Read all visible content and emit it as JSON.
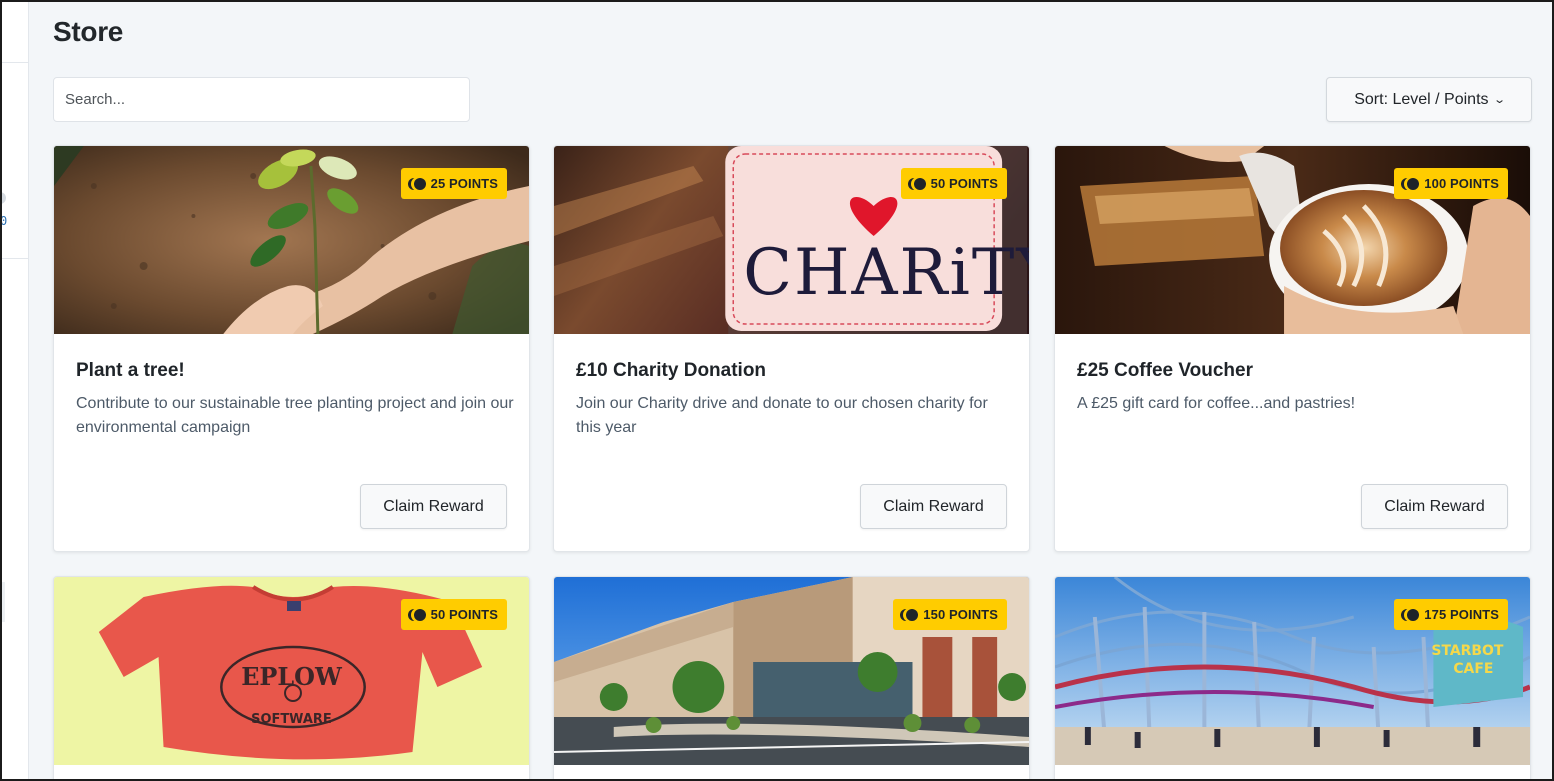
{
  "page": {
    "title": "Store"
  },
  "search": {
    "placeholder": "Search..."
  },
  "sort": {
    "label": "Sort: Level / Points",
    "icon": "chevron-down-icon"
  },
  "theme": {
    "badge_color": "#ffcc00",
    "background": "#f3f6f9"
  },
  "rewards": [
    {
      "points_label": "25 POINTS",
      "title": "Plant a tree!",
      "description": "Contribute to our sustainable tree planting project and join our environmental campaign",
      "button": "Claim Reward",
      "image": "seedling-planting-photo"
    },
    {
      "points_label": "50 POINTS",
      "title": "£10 Charity Donation",
      "description": "Join our Charity drive and donate to our chosen charity for this year",
      "button": "Claim Reward",
      "image": "charity-jar-photo"
    },
    {
      "points_label": "100 POINTS",
      "title": "£25 Coffee Voucher",
      "description": "A £25 gift card for coffee...and pastries!",
      "button": "Claim Reward",
      "image": "latte-art-photo"
    },
    {
      "points_label": "50 POINTS",
      "image": "eplow-tshirt-photo"
    },
    {
      "points_label": "150 POINTS",
      "image": "office-building-photo"
    },
    {
      "points_label": "175 POINTS",
      "image": "theme-park-photo"
    }
  ]
}
